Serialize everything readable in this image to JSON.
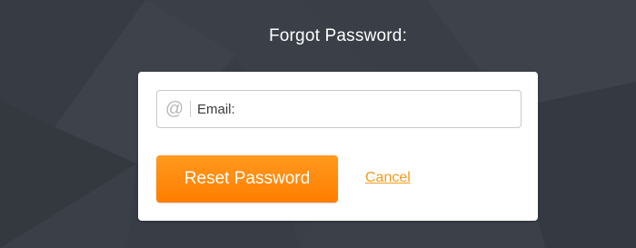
{
  "page": {
    "title": "Forgot Password:",
    "background_color": "#3a3f48"
  },
  "form": {
    "email_icon": "at-icon",
    "email_placeholder": "Email:",
    "email_value": "",
    "reset_label": "Reset Password",
    "cancel_label": "Cancel",
    "accent_color": "#ff8a0c",
    "link_color": "#f39a1c"
  }
}
